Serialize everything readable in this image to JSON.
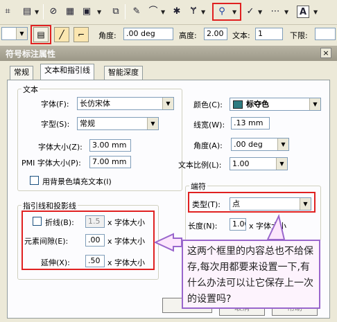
{
  "toolbar": {
    "top_icons": [
      "distance-icon",
      "table-icon",
      "circle-icon",
      "grid-icon",
      "frame-icon",
      "pencil-icon",
      "curve-icon",
      "star-icon",
      "y-icon",
      "search-probe-icon",
      "check-icon",
      "dots-icon",
      "text-A-icon"
    ],
    "angle_label": "角度:",
    "angle_value": ".00 deg",
    "height_label": "高度:",
    "height_value": "2.00",
    "text_label": "文本:",
    "text_value": "1",
    "lower_label": "下限:"
  },
  "dialog": {
    "title": "符号标注属性",
    "close": "×",
    "tabs": [
      "常规",
      "文本和指引线",
      "智能深度"
    ],
    "text_group": {
      "title": "文本",
      "font_label": "字体(F):",
      "font_value": "长仿宋体",
      "style_label": "字型(S):",
      "style_value": "常规",
      "size_label": "字体大小(Z):",
      "size_value": "3.00 mm",
      "pmi_label": "PMI 字体大小(P):",
      "pmi_value": "7.00 mm",
      "fill_bg_label": "用背景色填充文本(I)"
    },
    "right": {
      "color_label": "颜色(C):",
      "color_value": "标夺色",
      "linewidth_label": "线宽(W):",
      "linewidth_value": ".13 mm",
      "angle_label": "角度(A):",
      "angle_value": ".00 deg",
      "ratio_label": "文本比例(L):",
      "ratio_value": "1.00"
    },
    "leader_group": {
      "title": "指引线和投影线",
      "fold_label": "折线(B):",
      "fold_value": "1.5",
      "unit": "x 字体大小",
      "gap_label": "元素间隙(E):",
      "gap_value": ".00",
      "ext_label": "延伸(X):",
      "ext_value": ".50"
    },
    "terminator_group": {
      "title": "端符",
      "type_label": "类型(T):",
      "type_value": "点",
      "length_label": "长度(N):",
      "length_value": "1.00",
      "length_unit": "x 字体大小"
    },
    "buttons": {
      "ok": "确",
      "cancel": "取消",
      "help": "帮助"
    }
  },
  "annotation": {
    "text": "这两个框里的内容总也不给保存,每次用都要来设置一下,有什么办法可以让它保存上一次的设置吗?"
  },
  "colors": {
    "highlight": "#e02020",
    "callout_border": "#9966cc",
    "swatch": "#2e7b80"
  }
}
